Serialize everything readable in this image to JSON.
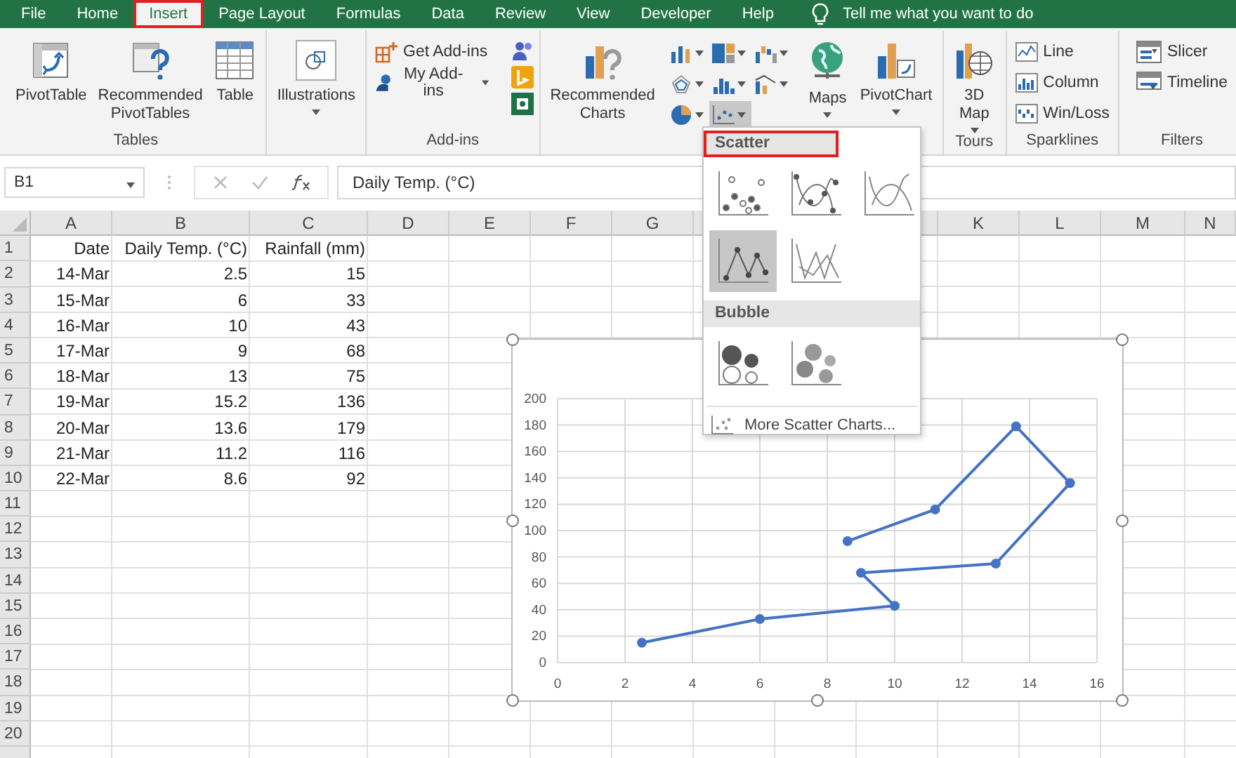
{
  "tabs": [
    {
      "label": "File",
      "selected": false,
      "highlighted": false
    },
    {
      "label": "Home",
      "selected": false,
      "highlighted": false
    },
    {
      "label": "Insert",
      "selected": true,
      "highlighted": true
    },
    {
      "label": "Page Layout",
      "selected": false,
      "highlighted": false
    },
    {
      "label": "Formulas",
      "selected": false,
      "highlighted": false
    },
    {
      "label": "Data",
      "selected": false,
      "highlighted": false
    },
    {
      "label": "Review",
      "selected": false,
      "highlighted": false
    },
    {
      "label": "View",
      "selected": false,
      "highlighted": false
    },
    {
      "label": "Developer",
      "selected": false,
      "highlighted": false
    },
    {
      "label": "Help",
      "selected": false,
      "highlighted": false
    }
  ],
  "tell_me": {
    "placeholder": "Tell me what you want to do"
  },
  "ribbon": {
    "groups": [
      {
        "kind": "large",
        "label": "Tables",
        "items": [
          {
            "kind": "pivot-table",
            "lines": [
              "PivotTable"
            ],
            "dropdown": false
          },
          {
            "kind": "recommended-pivot",
            "lines": [
              "Recommended",
              "PivotTables"
            ],
            "dropdown": false
          },
          {
            "kind": "table",
            "lines": [
              "Table"
            ],
            "dropdown": false
          }
        ]
      },
      {
        "kind": "large",
        "items": [
          {
            "kind": "illustrations",
            "lines": [
              "Illustrations"
            ],
            "dropdown": true
          }
        ]
      },
      {
        "kind": "addins",
        "label": "Add-ins",
        "items": [
          {
            "kind": "get-addins",
            "lines": [
              "Get Add-ins"
            ],
            "dropdown": false
          },
          {
            "kind": "my-addins",
            "lines": [
              "My Add-ins"
            ],
            "dropdown": true
          }
        ],
        "extras": [
          {
            "kind": "people"
          },
          {
            "kind": "bing"
          },
          {
            "kind": "visio"
          }
        ]
      },
      {
        "kind": "charts",
        "items": [
          {
            "kind": "recommended-charts",
            "lines": [
              "Recommended",
              "Charts"
            ],
            "dropdown": false
          }
        ],
        "small": [
          {
            "kind": "column",
            "pressed": false
          },
          {
            "kind": "hierarchy",
            "pressed": false
          },
          {
            "kind": "waterfall",
            "pressed": false
          },
          {
            "kind": "radar",
            "pressed": false
          },
          {
            "kind": "statistic",
            "pressed": false
          },
          {
            "kind": "combo",
            "pressed": false
          },
          {
            "kind": "pie",
            "pressed": false
          },
          {
            "kind": "scatter",
            "pressed": true
          }
        ],
        "after": [
          {
            "kind": "globe",
            "lines": [
              "Maps"
            ],
            "dropdown": true
          },
          {
            "kind": "pivot-chart",
            "lines": [
              "PivotChart"
            ],
            "dropdown": true
          }
        ]
      },
      {
        "kind": "large",
        "label": "Tours",
        "items": [
          {
            "kind": "map-globe",
            "lines": [
              "3D",
              "Map"
            ],
            "dropdown": true
          }
        ]
      },
      {
        "kind": "list",
        "label": "Sparklines",
        "items": [
          {
            "kind": "spark-line",
            "lines": [
              "Line"
            ]
          },
          {
            "kind": "spark-column",
            "lines": [
              "Column"
            ]
          },
          {
            "kind": "spark-winloss",
            "lines": [
              "Win/Loss"
            ]
          }
        ]
      },
      {
        "kind": "list",
        "label": "Filters",
        "items": [
          {
            "kind": "slicer",
            "lines": [
              "Slicer"
            ]
          },
          {
            "kind": "timeline",
            "lines": [
              "Timeline"
            ]
          }
        ]
      }
    ]
  },
  "formula_bar": {
    "name_box": "B1",
    "value": "Daily Temp. (°C)"
  },
  "sheet": {
    "columns_left": [
      "A",
      "B",
      "C",
      "D",
      "E",
      "F",
      "G"
    ],
    "columns_right": [
      "K",
      "L",
      "M",
      "N"
    ],
    "rows": [
      {
        "number": "1",
        "cells": [
          "Date",
          "Daily Temp. (°C)",
          "Rainfall (mm)"
        ]
      },
      {
        "number": "2",
        "cells": [
          "14-Mar",
          "2.5",
          "15"
        ]
      },
      {
        "number": "3",
        "cells": [
          "15-Mar",
          "6",
          "33"
        ]
      },
      {
        "number": "4",
        "cells": [
          "16-Mar",
          "10",
          "43"
        ]
      },
      {
        "number": "5",
        "cells": [
          "17-Mar",
          "9",
          "68"
        ]
      },
      {
        "number": "6",
        "cells": [
          "18-Mar",
          "13",
          "75"
        ]
      },
      {
        "number": "7",
        "cells": [
          "19-Mar",
          "15.2",
          "136"
        ]
      },
      {
        "number": "8",
        "cells": [
          "20-Mar",
          "13.6",
          "179"
        ]
      },
      {
        "number": "9",
        "cells": [
          "21-Mar",
          "11.2",
          "116"
        ]
      },
      {
        "number": "10",
        "cells": [
          "22-Mar",
          "8.6",
          "92"
        ]
      },
      {
        "number": "11"
      },
      {
        "number": "12"
      },
      {
        "number": "13"
      },
      {
        "number": "14"
      },
      {
        "number": "15"
      },
      {
        "number": "16"
      },
      {
        "number": "17"
      },
      {
        "number": "18"
      },
      {
        "number": "19"
      },
      {
        "number": "20"
      }
    ]
  },
  "chart": {
    "selected": true,
    "chart_data": {
      "type": "line",
      "x": [
        2.5,
        6,
        10,
        9,
        13,
        15.2,
        13.6,
        11.2,
        8.6
      ],
      "series": [
        {
          "color": "#4472c4",
          "marker": true,
          "values": [
            15,
            33,
            43,
            68,
            75,
            136,
            179,
            116,
            92
          ]
        }
      ],
      "grid": true,
      "xlim": [
        0,
        16
      ],
      "ylim": [
        0,
        200
      ],
      "xticks": [
        0,
        2,
        4,
        6,
        8,
        10,
        12,
        14,
        16
      ],
      "yticks": [
        0,
        20,
        40,
        60,
        80,
        100,
        120,
        140,
        160,
        180,
        200
      ]
    }
  },
  "chart_menu": {
    "sections": [
      {
        "title": "Scatter",
        "highlighted": true,
        "options": [
          {
            "kind": "markers",
            "selected": false
          },
          {
            "kind": "smooth-markers",
            "selected": false
          },
          {
            "kind": "smooth",
            "selected": false
          },
          {
            "kind": "straight-markers",
            "selected": true
          },
          {
            "kind": "straight",
            "selected": false
          }
        ]
      },
      {
        "title": "Bubble",
        "highlighted": false,
        "options": [
          {
            "kind": "bubble",
            "selected": false
          },
          {
            "kind": "bubble-3d",
            "selected": false
          }
        ]
      }
    ],
    "more": "More Scatter Charts..."
  }
}
